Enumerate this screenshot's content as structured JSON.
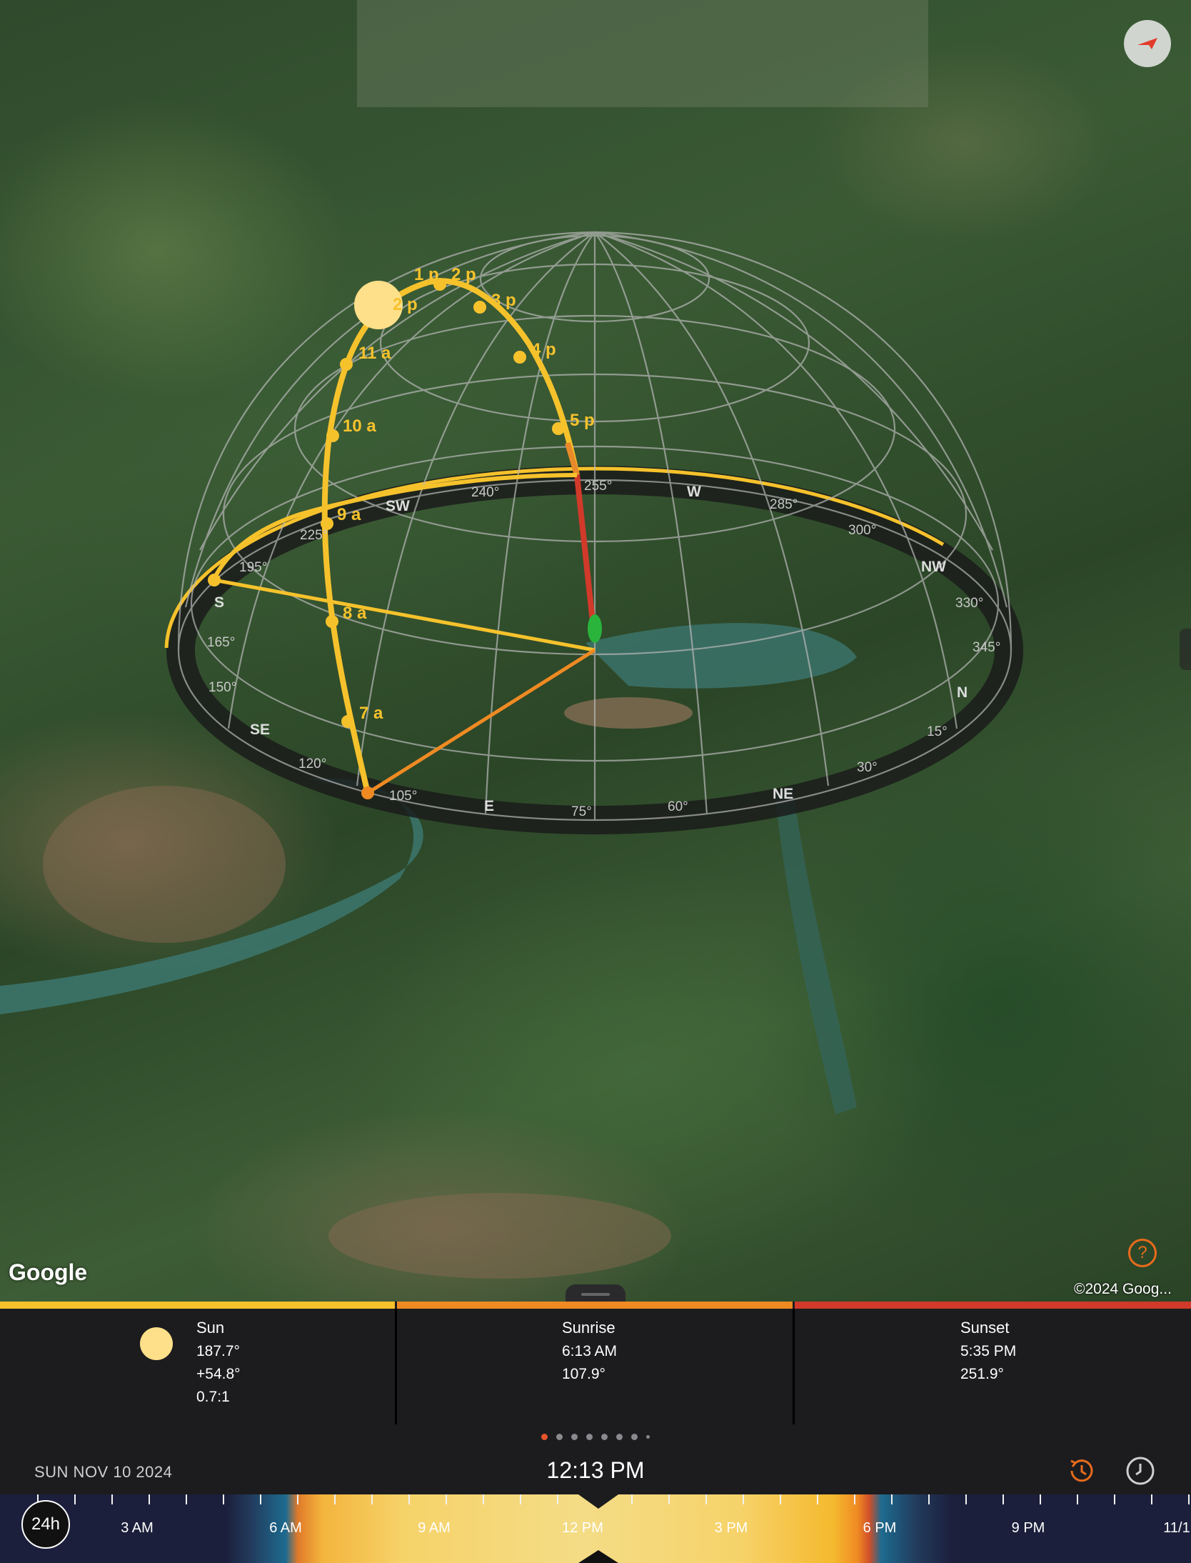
{
  "map": {
    "attribution_logo": "Google",
    "copyright": "©2024 Goog...",
    "help_label": "?",
    "compass_labels": [
      "W",
      "SW",
      "S",
      "SE",
      "E",
      "NE",
      "N",
      "NW"
    ],
    "degree_labels": [
      "255°",
      "240°",
      "285°",
      "300°",
      "330°",
      "345°",
      "15°",
      "30°",
      "60°",
      "75°",
      "105°",
      "120°",
      "150°",
      "165°",
      "195°",
      "225°"
    ],
    "hour_labels": [
      "1 p",
      "2 p",
      "2 p",
      "3 p",
      "4 p",
      "5 p",
      "11 a",
      "10 a",
      "9 a",
      "8 a",
      "7 a"
    ]
  },
  "info": {
    "sun": {
      "name": "Sun",
      "azimuth": "187.7°",
      "elevation": "+54.8°",
      "shadow_ratio": "0.7:1"
    },
    "sunrise": {
      "name": "Sunrise",
      "time": "6:13 AM",
      "azimuth": "107.9°"
    },
    "sunset": {
      "name": "Sunset",
      "time": "5:35 PM",
      "azimuth": "251.9°"
    },
    "colors": {
      "sun": "#f6c22c",
      "sunrise": "#ef8a23",
      "sunset": "#d13a2a"
    }
  },
  "pager": {
    "count": 8,
    "active_index": 0
  },
  "controls": {
    "date": "SUN NOV 10 2024",
    "time": "12:13 PM",
    "history_icon": "clock-history-icon",
    "clock_icon": "clock-icon"
  },
  "timeline": {
    "mode_button": "24h",
    "labels": [
      "3 AM",
      "6 AM",
      "9 AM",
      "12 PM",
      "3 PM",
      "6 PM",
      "9 PM",
      "11/1"
    ]
  }
}
